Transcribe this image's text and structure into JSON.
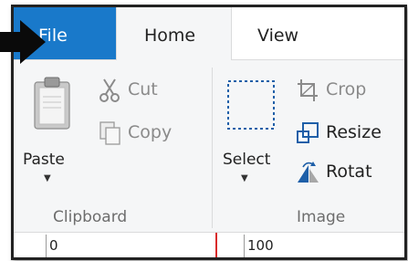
{
  "tabs": {
    "file": "File",
    "home": "Home",
    "view": "View"
  },
  "clipboard": {
    "paste": "Paste",
    "cut": "Cut",
    "copy": "Copy",
    "group_label": "Clipboard"
  },
  "image": {
    "select": "Select",
    "crop": "Crop",
    "resize": "Resize",
    "rotate": "Rotat",
    "group_label": "Image"
  },
  "ruler": {
    "mark_0": "0",
    "mark_100": "100"
  },
  "colors": {
    "file_tab": "#1979ca",
    "ribbon_bg": "#f5f6f7",
    "ruler_marker": "#d92a2a"
  },
  "icons": [
    "callout-arrow-icon",
    "paste-clipboard-icon",
    "scissors-icon",
    "copy-icon",
    "select-rectangle-icon",
    "crop-icon",
    "resize-icon",
    "rotate-icon",
    "dropdown-arrow-icon"
  ]
}
